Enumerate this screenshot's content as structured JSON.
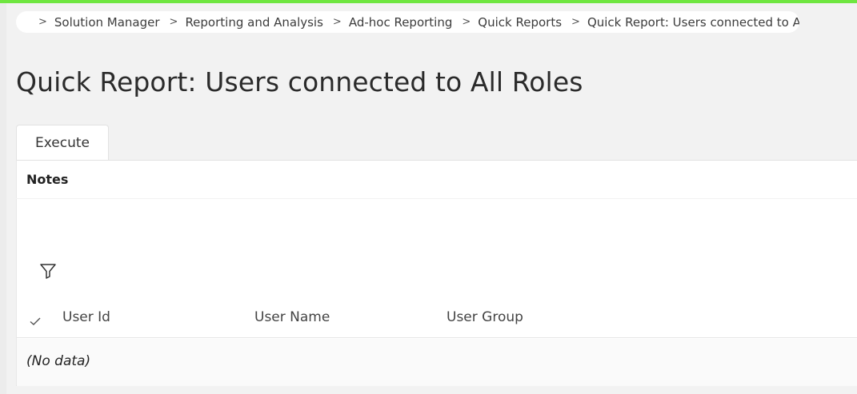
{
  "breadcrumb": {
    "items": [
      "Solution Manager",
      "Reporting and Analysis",
      "Ad-hoc Reporting",
      "Quick Reports",
      "Quick Report: Users connected to All Roles"
    ]
  },
  "page": {
    "title": "Quick Report: Users connected to All Roles"
  },
  "toolbar": {
    "execute_label": "Execute"
  },
  "notes": {
    "title": "Notes"
  },
  "grid": {
    "columns": [
      "User Id",
      "User Name",
      "User Group"
    ],
    "empty_text": "(No data)"
  },
  "colors": {
    "accent_bar": "#6fe640",
    "home_dot": "#1a67c8"
  }
}
